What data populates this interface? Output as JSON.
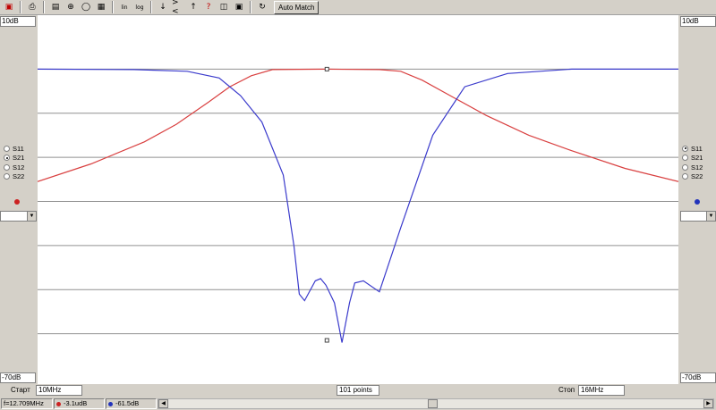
{
  "toolbar": {
    "auto_match_label": "Auto Match",
    "icons": [
      "open-file-icon",
      "print-icon",
      "chart-icon",
      "smith-chart-icon",
      "polar-chart-icon",
      "table-icon",
      "linear-scale-icon",
      "log-scale-icon",
      "marker-down-icon",
      "zoom-in-icon",
      "marker-up-icon",
      "help-icon",
      "measure-icon",
      "calibrate-icon"
    ]
  },
  "left_panel": {
    "top_level": "10dB",
    "bottom_level": "-70dB",
    "params": [
      {
        "label": "S11",
        "selected": false
      },
      {
        "label": "S21",
        "selected": true
      },
      {
        "label": "S12",
        "selected": false
      },
      {
        "label": "S22",
        "selected": false
      }
    ],
    "trace_color": "#cc2222"
  },
  "right_panel": {
    "top_level": "10dB",
    "bottom_level": "-70dB",
    "params": [
      {
        "label": "S11",
        "selected": true
      },
      {
        "label": "S21",
        "selected": false
      },
      {
        "label": "S12",
        "selected": false
      },
      {
        "label": "S22",
        "selected": false
      }
    ],
    "trace_color": "#2233bb"
  },
  "frequency_bar": {
    "start_label": "Старт",
    "start_value": "10MHz",
    "points_value": "101 points",
    "stop_label": "Стоп",
    "stop_value": "16MHz"
  },
  "status_bar": {
    "marker_freq": "f=12.709MHz",
    "marker_red_value": "-3.1udB",
    "marker_blue_value": "-61.5dB"
  },
  "chart_data": {
    "type": "line",
    "x_range_mhz": [
      10,
      16
    ],
    "ylim": [
      -70,
      10
    ],
    "y_unit": "dB",
    "grid": "horizontal lines every 10 dB",
    "series": [
      {
        "color": "#d94040",
        "x": [
          10.0,
          10.5,
          11.0,
          11.3,
          11.6,
          11.8,
          12.0,
          12.2,
          12.7,
          13.2,
          13.4,
          13.6,
          13.9,
          14.2,
          14.6,
          15.0,
          15.5,
          16.0
        ],
        "y": [
          -25.5,
          -21.5,
          -16.5,
          -12.5,
          -7.5,
          -4,
          -1.5,
          -0.1,
          0,
          -0.1,
          -0.5,
          -2.5,
          -6.5,
          -10.5,
          -15,
          -18.5,
          -22.5,
          -25.5
        ]
      },
      {
        "color": "#3b3bcc",
        "x": [
          10.0,
          10.9,
          11.4,
          11.7,
          11.9,
          12.1,
          12.3,
          12.4,
          12.45,
          12.5,
          12.6,
          12.65,
          12.7,
          12.78,
          12.85,
          12.92,
          12.97,
          13.05,
          13.2,
          13.4,
          13.7,
          14.0,
          14.4,
          15.0,
          16.0
        ],
        "y": [
          0,
          -0.1,
          -0.5,
          -2,
          -6,
          -12,
          -24,
          -40,
          -51,
          -52.5,
          -48,
          -47.5,
          -49,
          -53,
          -62,
          -53,
          -48.5,
          -48,
          -50.5,
          -36,
          -15,
          -4,
          -1,
          0,
          0
        ]
      }
    ],
    "markers": [
      {
        "series": 0,
        "x": 12.709,
        "y": 0
      },
      {
        "series": 1,
        "x": 12.709,
        "y": -61.5
      }
    ]
  }
}
